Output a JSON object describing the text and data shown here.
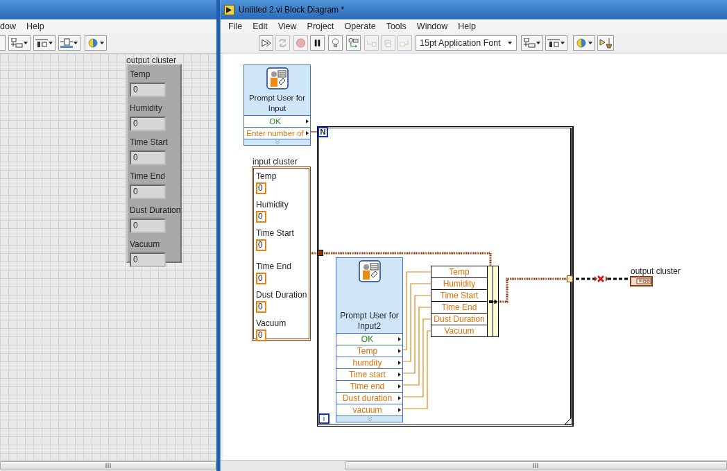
{
  "front_panel": {
    "menu": [
      "dow",
      "Help"
    ],
    "output_cluster": {
      "label": "output cluster",
      "fields": [
        {
          "label": "Temp",
          "value": "0"
        },
        {
          "label": "Humidity",
          "value": "0"
        },
        {
          "label": "Time Start",
          "value": "0"
        },
        {
          "label": "Time End",
          "value": "0"
        },
        {
          "label": "Dust Duration",
          "value": "0"
        },
        {
          "label": "Vacuum",
          "value": "0"
        }
      ]
    }
  },
  "block_diagram": {
    "window": {
      "title": "Untitled 2.vi Block Diagram *"
    },
    "menu": [
      "File",
      "Edit",
      "View",
      "Project",
      "Operate",
      "Tools",
      "Window",
      "Help"
    ],
    "toolbar": {
      "font": "15pt Application Font"
    },
    "prompt_1": {
      "title": "Prompt User for Input",
      "outputs": [
        {
          "label": "OK",
          "kind": "boolean"
        },
        {
          "label": "Enter number of",
          "kind": "numeric"
        }
      ]
    },
    "for_loop": {
      "count_terminal": "N",
      "index_terminal": "i"
    },
    "input_cluster": {
      "label": "input cluster",
      "fields": [
        {
          "label": "Temp",
          "value": "0"
        },
        {
          "label": "Humidity",
          "value": "0"
        },
        {
          "label": "Time Start",
          "value": "0"
        },
        {
          "label": "Time End",
          "value": "0"
        },
        {
          "label": "Dust Duration",
          "value": "0"
        },
        {
          "label": "Vacuum",
          "value": "0"
        }
      ]
    },
    "prompt_2": {
      "title": "Prompt User for Input2",
      "outputs": [
        {
          "label": "OK",
          "kind": "boolean"
        },
        {
          "label": "Temp",
          "kind": "numeric"
        },
        {
          "label": "humdity",
          "kind": "numeric"
        },
        {
          "label": "Time start",
          "kind": "numeric"
        },
        {
          "label": "Time end",
          "kind": "numeric"
        },
        {
          "label": "Dust duration",
          "kind": "numeric"
        },
        {
          "label": "vacuum",
          "kind": "numeric"
        }
      ]
    },
    "bundle": {
      "elements": [
        "Temp",
        "Humidity",
        "Time Start",
        "Time End",
        "Dust Duration",
        "Vacuum"
      ]
    },
    "output_cluster": {
      "label": "output cluster"
    }
  }
}
